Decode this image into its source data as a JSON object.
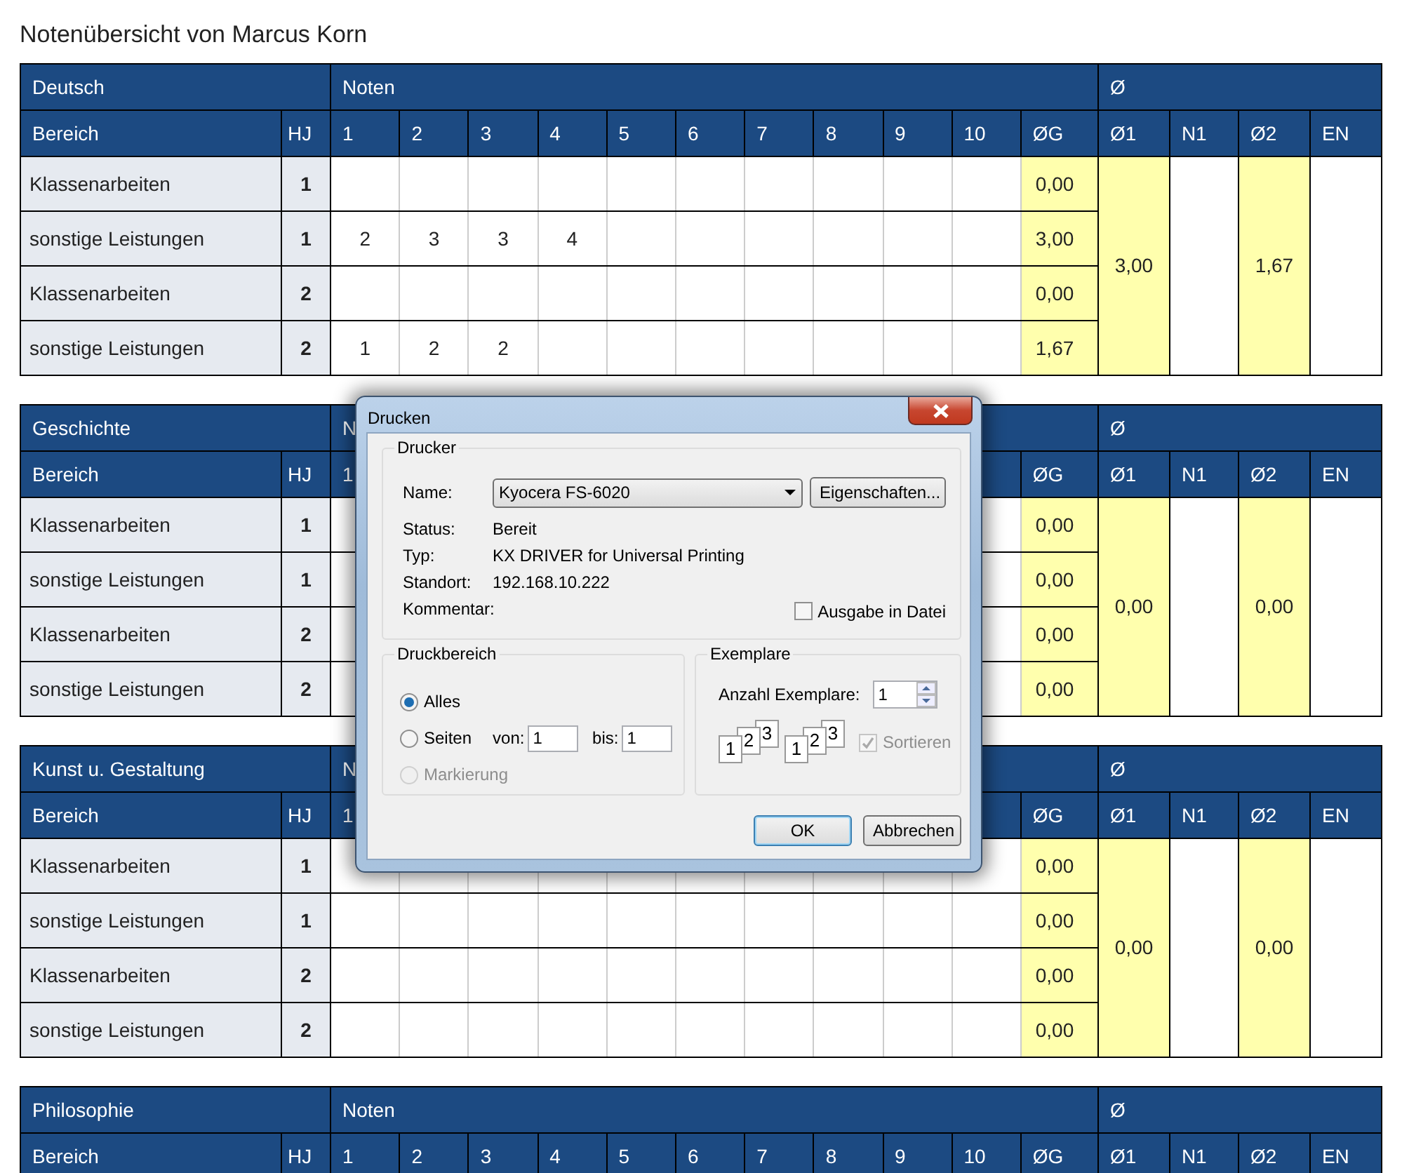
{
  "page_title": "Notenübersicht von Marcus Korn",
  "subjects": [
    {
      "name": "Deutsch",
      "noten_label": "Noten",
      "avg_label": "Ø",
      "columns": {
        "bereich": "Bereich",
        "hj": "HJ",
        "grades": [
          "1",
          "2",
          "3",
          "4",
          "5",
          "6",
          "7",
          "8",
          "9",
          "10"
        ],
        "og": "ØG",
        "o1": "Ø1",
        "n1": "N1",
        "o2": "Ø2",
        "en": "EN"
      },
      "o1": "3,00",
      "o2": "1,67",
      "rows": [
        {
          "bereich": "Klassenarbeiten",
          "hj": "1",
          "grades": [],
          "og": "0,00"
        },
        {
          "bereich": "sonstige Leistungen",
          "hj": "1",
          "grades": [
            "2",
            "3",
            "3",
            "4"
          ],
          "og": "3,00"
        },
        {
          "bereich": "Klassenarbeiten",
          "hj": "2",
          "grades": [],
          "og": "0,00"
        },
        {
          "bereich": "sonstige Leistungen",
          "hj": "2",
          "grades": [
            "1",
            "2",
            "2"
          ],
          "og": "1,67"
        }
      ]
    },
    {
      "name": "Geschichte",
      "noten_label": "N",
      "avg_label": "Ø",
      "columns": {
        "bereich": "Bereich",
        "hj": "HJ",
        "grades": [
          "1"
        ],
        "og": "ØG",
        "o1": "Ø1",
        "n1": "N1",
        "o2": "Ø2",
        "en": "EN"
      },
      "o1": "0,00",
      "o2": "0,00",
      "rows": [
        {
          "bereich": "Klassenarbeiten",
          "hj": "1",
          "grades": [],
          "og": "0,00"
        },
        {
          "bereich": "sonstige Leistungen",
          "hj": "1",
          "grades": [],
          "og": "0,00"
        },
        {
          "bereich": "Klassenarbeiten",
          "hj": "2",
          "grades": [],
          "og": "0,00"
        },
        {
          "bereich": "sonstige Leistungen",
          "hj": "2",
          "grades": [],
          "og": "0,00"
        }
      ]
    },
    {
      "name": "Kunst u. Gestaltung",
      "noten_label": "N",
      "avg_label": "Ø",
      "columns": {
        "bereich": "Bereich",
        "hj": "HJ",
        "grades": [
          "1"
        ],
        "og": "ØG",
        "o1": "Ø1",
        "n1": "N1",
        "o2": "Ø2",
        "en": "EN"
      },
      "o1": "0,00",
      "o2": "0,00",
      "rows": [
        {
          "bereich": "Klassenarbeiten",
          "hj": "1",
          "grades": [],
          "og": "0,00"
        },
        {
          "bereich": "sonstige Leistungen",
          "hj": "1",
          "grades": [],
          "og": "0,00"
        },
        {
          "bereich": "Klassenarbeiten",
          "hj": "2",
          "grades": [],
          "og": "0,00"
        },
        {
          "bereich": "sonstige Leistungen",
          "hj": "2",
          "grades": [],
          "og": "0,00"
        }
      ]
    },
    {
      "name": "Philosophie",
      "noten_label": "Noten",
      "avg_label": "Ø",
      "columns": {
        "bereich": "Bereich",
        "hj": "HJ",
        "grades": [
          "1",
          "2",
          "3",
          "4",
          "5",
          "6",
          "7",
          "8",
          "9",
          "10"
        ],
        "og": "ØG",
        "o1": "Ø1",
        "n1": "N1",
        "o2": "Ø2",
        "en": "EN"
      }
    }
  ],
  "print_dialog": {
    "title": "Drucken",
    "printer": {
      "legend": "Drucker",
      "name_label": "Name:",
      "name_value": "Kyocera FS-6020",
      "properties_button": "Eigenschaften...",
      "info": [
        {
          "label": "Status:",
          "value": "Bereit"
        },
        {
          "label": "Typ:",
          "value": "KX DRIVER for Universal Printing"
        },
        {
          "label": "Standort:",
          "value": "192.168.10.222"
        },
        {
          "label": "Kommentar:"
        }
      ],
      "print_to_file": {
        "label": "Ausgabe in Datei",
        "checked": false
      }
    },
    "range": {
      "legend": "Druckbereich",
      "options": [
        {
          "label": "Alles",
          "selected": true,
          "disabled": false
        },
        {
          "label": "Seiten",
          "selected": false,
          "disabled": false,
          "from_label": "von:",
          "from_value": "1",
          "to_label": "bis:",
          "to_value": "1"
        },
        {
          "label": "Markierung",
          "selected": false,
          "disabled": true
        }
      ]
    },
    "copies": {
      "legend": "Exemplare",
      "count_label": "Anzahl Exemplare:",
      "count_value": "1",
      "stacks": [
        [
          "3",
          "2",
          "1"
        ],
        [
          "3",
          "2",
          "1"
        ]
      ],
      "collate": {
        "label": "Sortieren",
        "checked": true,
        "disabled": true
      }
    },
    "buttons": [
      {
        "label": "OK",
        "default": true
      },
      {
        "label": "Abbrechen",
        "default": false
      }
    ]
  }
}
